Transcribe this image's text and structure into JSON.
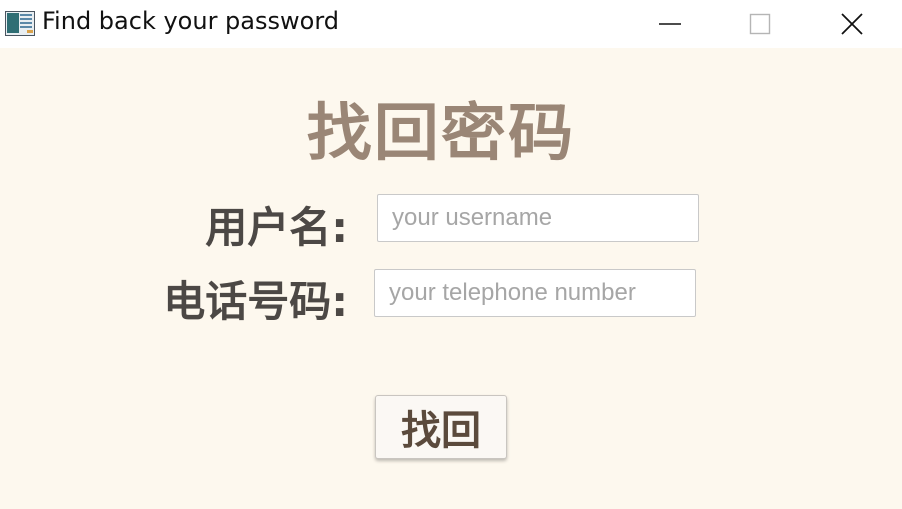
{
  "window": {
    "title": "Find back your password",
    "icon": "app-window-icon",
    "controls": [
      "minimize-icon",
      "maximize-icon",
      "close-icon"
    ]
  },
  "form": {
    "heading": "找回密码",
    "username_label": "用户名:",
    "username_placeholder": "your username",
    "phone_label": "电话号码:",
    "phone_placeholder": "your telephone number",
    "submit_label": "找回"
  },
  "colors": {
    "background": "#fdf8ee",
    "heading": "#9a8676",
    "label": "#4c4845",
    "button_text": "#5b4a3c"
  }
}
